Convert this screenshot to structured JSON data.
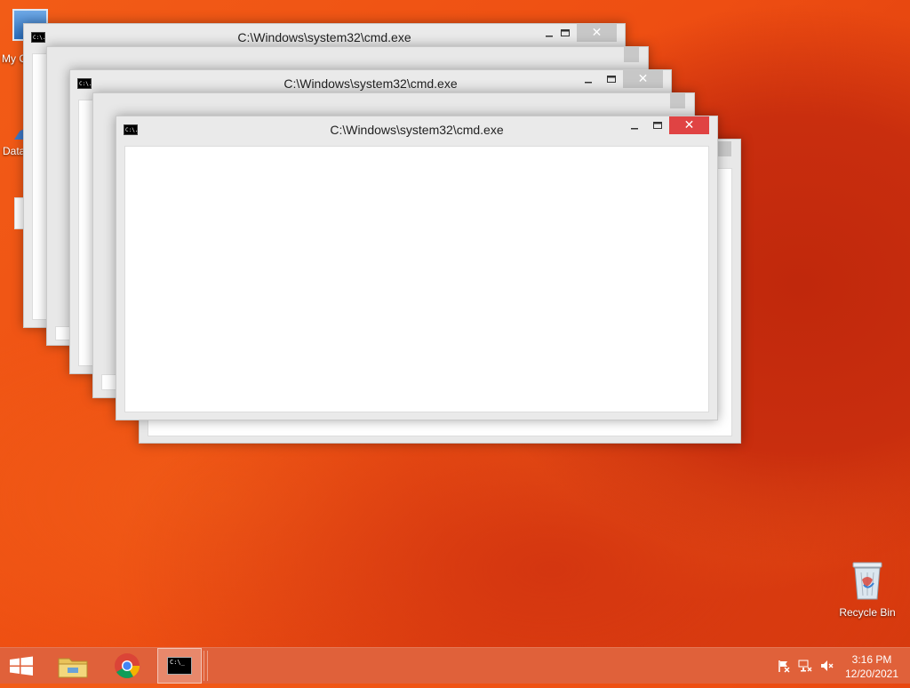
{
  "desktop": {
    "icons": {
      "my_computer": "My C",
      "data": "Data",
      "recycle_bin": "Recycle Bin"
    }
  },
  "windows": [
    {
      "title": "C:\\Windows\\system32\\cmd.exe",
      "active": false
    },
    {
      "title": "C:\\Windows\\system32\\cmd.exe",
      "active": false
    },
    {
      "title": "C:\\Windows\\system32\\cmd.exe",
      "active": true
    }
  ],
  "window_icon_text": "C:\\.",
  "taskbar": {
    "cmd_icon_text": "C:\\_",
    "clock_time": "3:16 PM",
    "clock_date": "12/20/2021"
  },
  "colors": {
    "accent_close": "#e04343",
    "taskbar": "#e0613a",
    "wallpaper": "#ee4e12"
  }
}
